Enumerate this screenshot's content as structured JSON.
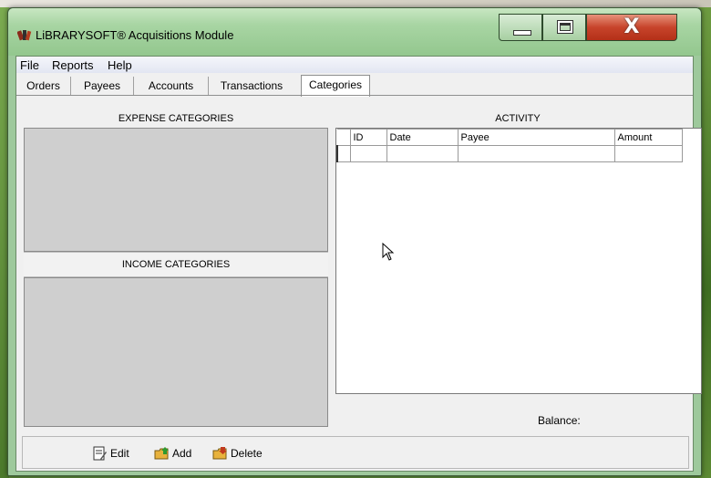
{
  "window": {
    "title": "LiBRARYSOFT® Acquisitions Module",
    "close_glyph": "X"
  },
  "menu": [
    "File",
    "Reports",
    "Help"
  ],
  "tabs": [
    "Orders",
    "Payees",
    "Accounts",
    "Transactions",
    "Categories"
  ],
  "active_tab": "Categories",
  "expense": {
    "header": "EXPENSE CATEGORIES"
  },
  "income": {
    "header": "INCOME CATEGORIES"
  },
  "activity": {
    "header": "ACTIVITY",
    "columns": [
      "ID",
      "Date",
      "Payee",
      "Amount"
    ],
    "rows": [
      [
        "",
        "",
        "",
        ""
      ]
    ]
  },
  "balance_label": "Balance:",
  "toolbar": {
    "edit": "Edit",
    "add": "Add",
    "delete": "Delete"
  },
  "icons": {
    "app": "books-icon",
    "minimize": "minimize-icon",
    "maximize": "maximize-icon",
    "close": "close-icon",
    "edit": "edit-document-icon",
    "add": "add-folder-icon",
    "delete": "delete-folder-icon",
    "cursor": "mouse-pointer-icon"
  },
  "colors": {
    "titlebar": "#a8d5a3",
    "close_button": "#c7442b",
    "panel_gray": "#cfcfcf"
  }
}
